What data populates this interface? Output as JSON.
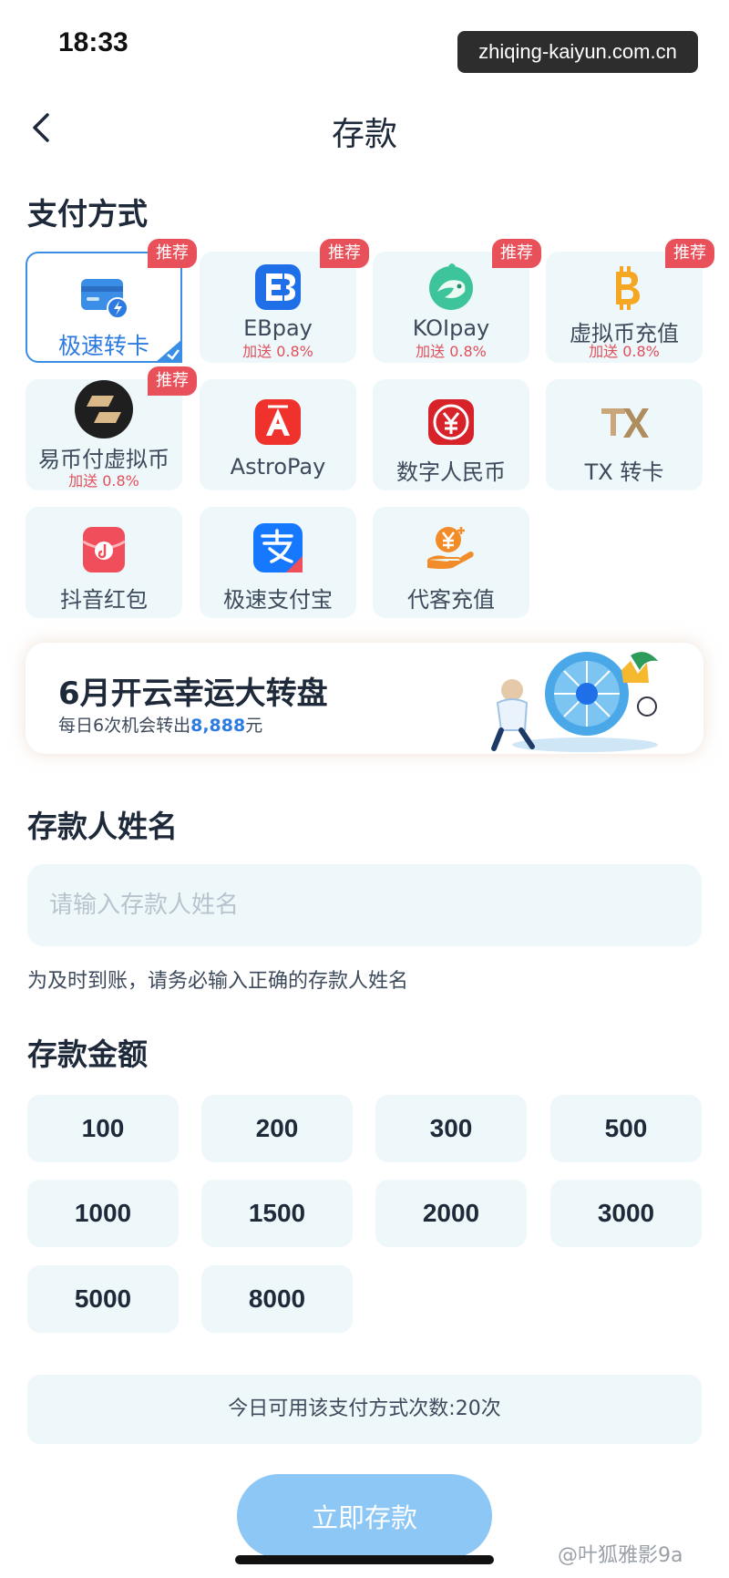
{
  "status": {
    "time": "18:33",
    "watermark": "zhiqing-kaiyun.com.cn"
  },
  "nav": {
    "title": "存款"
  },
  "payment": {
    "title": "支付方式",
    "badge": "推荐",
    "methods": [
      {
        "label": "极速转卡",
        "icon": "card-lightning-icon",
        "recommended": true,
        "selected": true
      },
      {
        "label": "EBpay",
        "icon": "ebpay-icon",
        "bonus": "加送 0.8%",
        "recommended": true
      },
      {
        "label": "KOIpay",
        "icon": "koi-fish-icon",
        "bonus": "加送 0.8%",
        "recommended": true
      },
      {
        "label": "虚拟币充值",
        "icon": "bitcoin-icon",
        "bonus": "加送 0.8%",
        "recommended": true
      },
      {
        "label": "易币付虚拟币",
        "icon": "yibifu-icon",
        "bonus": "加送 0.8%",
        "recommended": true
      },
      {
        "label": "AstroPay",
        "icon": "astropay-icon"
      },
      {
        "label": "数字人民币",
        "icon": "digital-rmb-icon"
      },
      {
        "label": "TX 转卡",
        "icon": "tx-icon"
      },
      {
        "label": "抖音红包",
        "icon": "douyin-redpacket-icon"
      },
      {
        "label": "极速支付宝",
        "icon": "alipay-icon"
      },
      {
        "label": "代客充值",
        "icon": "agent-recharge-icon"
      }
    ]
  },
  "banner": {
    "title": "6月开云幸运大转盘",
    "subtitle_prefix": "每日6次机会转出",
    "subtitle_amount": "8,888",
    "subtitle_suffix": "元"
  },
  "depositor": {
    "title": "存款人姓名",
    "placeholder": "请输入存款人姓名",
    "hint": "为及时到账，请务必输入正确的存款人姓名"
  },
  "amount": {
    "title": "存款金额",
    "options": [
      "100",
      "200",
      "300",
      "500",
      "1000",
      "1500",
      "2000",
      "3000",
      "5000",
      "8000"
    ]
  },
  "limit_text": "今日可用该支付方式次数:20次",
  "submit_label": "立即存款",
  "credit": "@叶狐雅影9a",
  "colors": {
    "accent": "#3a8ee6",
    "badge": "#e8505a",
    "tile_bg": "#eef7f9",
    "button": "#8cc7f5"
  }
}
